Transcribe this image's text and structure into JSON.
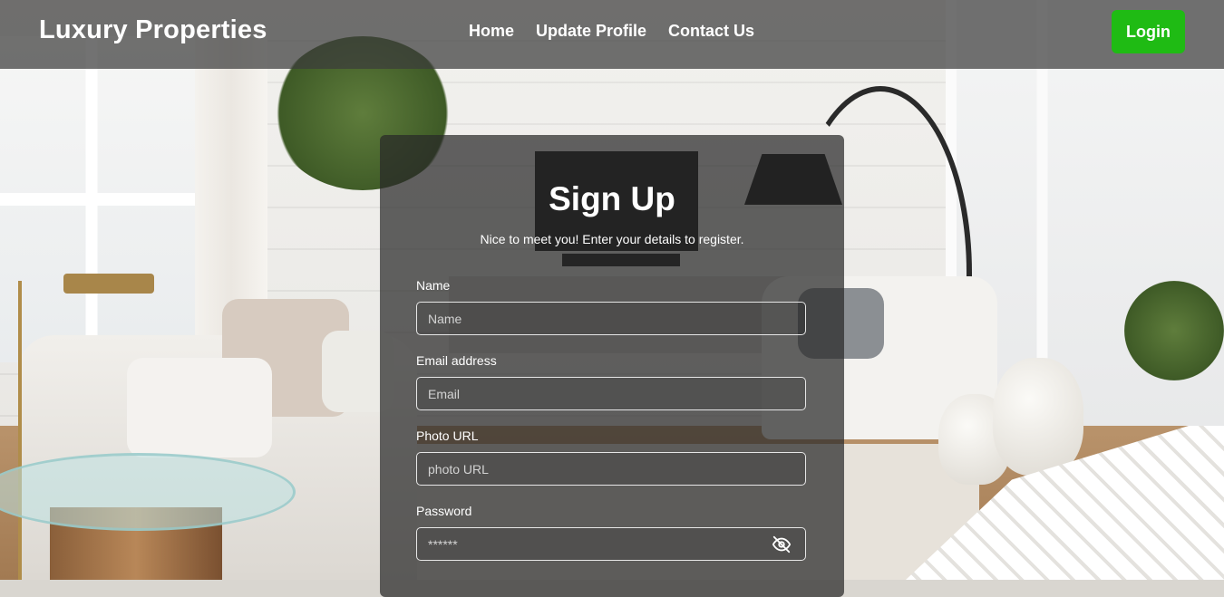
{
  "navbar": {
    "brand": "Luxury Properties",
    "links": [
      {
        "label": "Home"
      },
      {
        "label": "Update Profile"
      },
      {
        "label": "Contact Us"
      }
    ],
    "login_label": "Login",
    "login_color": "#1fbb14"
  },
  "signup": {
    "title": "Sign Up",
    "subtitle": "Nice to meet you! Enter your details to register.",
    "fields": {
      "name": {
        "label": "Name",
        "placeholder": "Name"
      },
      "email": {
        "label": "Email address",
        "placeholder": "Email"
      },
      "photo": {
        "label": "Photo URL",
        "placeholder": "photo URL"
      },
      "password": {
        "label": "Password",
        "placeholder": "******",
        "toggle_icon": "eye-off-icon"
      }
    }
  }
}
